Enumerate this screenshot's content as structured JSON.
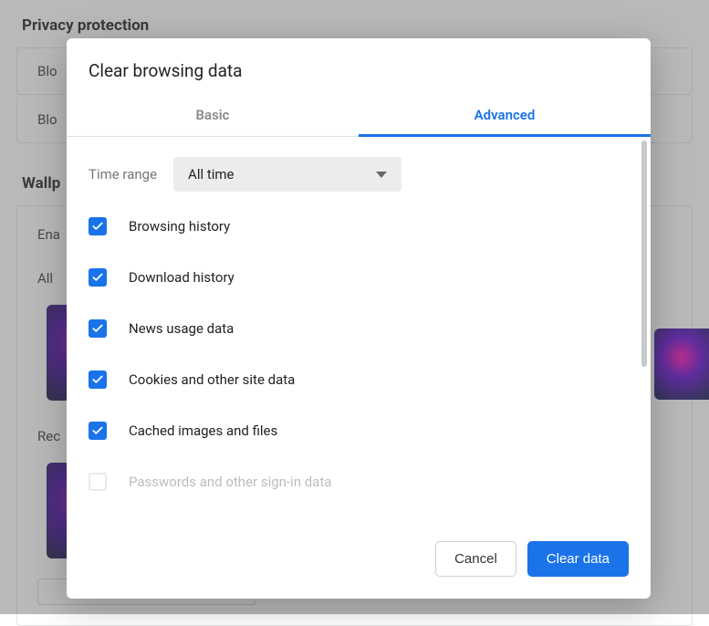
{
  "background": {
    "privacy_heading": "Privacy protection",
    "row1": "Blo",
    "row2": "Blo",
    "wallpaper_heading": "Wallp",
    "enable_label": "Ena",
    "all_label": "All",
    "rec_label": "Rec"
  },
  "dialog": {
    "title": "Clear browsing data",
    "tabs": {
      "basic": "Basic",
      "advanced": "Advanced"
    },
    "timerange_label": "Time range",
    "timerange_value": "All time",
    "items": [
      {
        "label": "Browsing history",
        "checked": true
      },
      {
        "label": "Download history",
        "checked": true
      },
      {
        "label": "News usage data",
        "checked": true
      },
      {
        "label": "Cookies and other site data",
        "checked": true
      },
      {
        "label": "Cached images and files",
        "checked": true
      },
      {
        "label": "Passwords and other sign-in data",
        "checked": false
      }
    ],
    "footer": {
      "cancel": "Cancel",
      "clear": "Clear data"
    }
  }
}
